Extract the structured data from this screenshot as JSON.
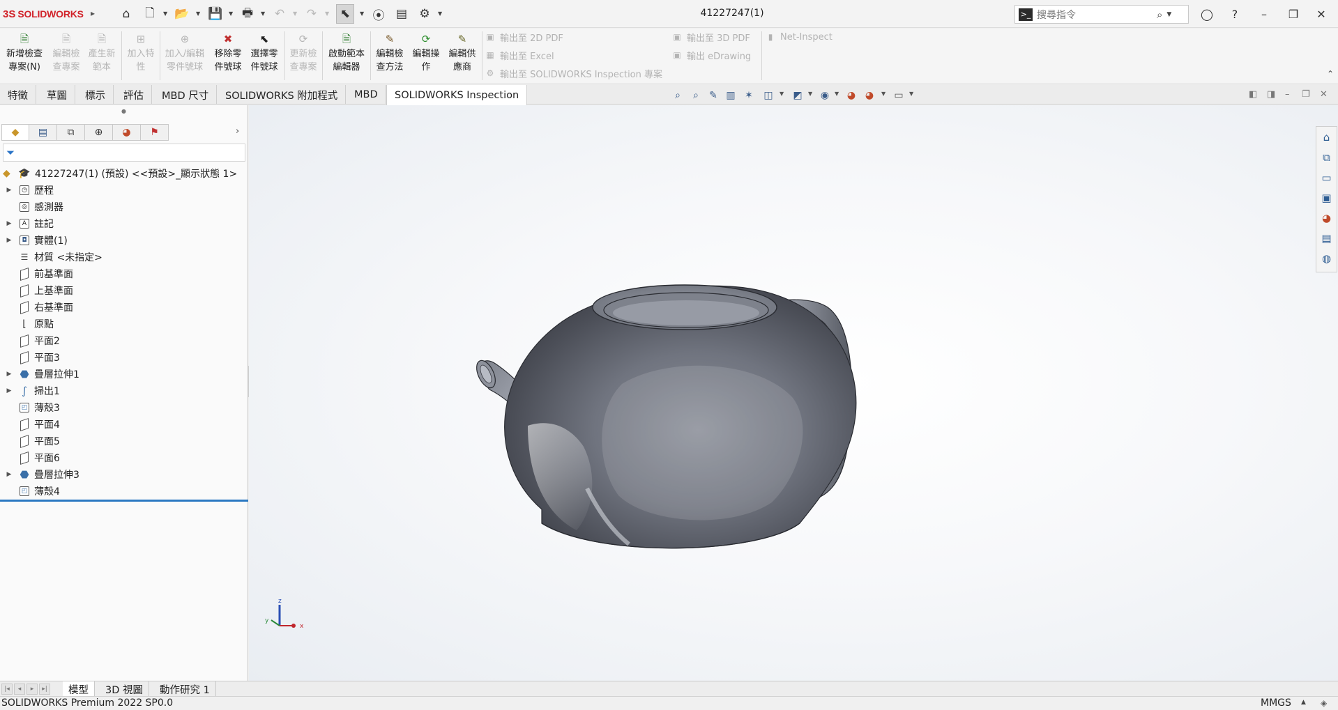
{
  "app": {
    "brand_ds": "3S",
    "brand_name": "SOLIDWORKS",
    "document_title": "41227247(1)"
  },
  "search": {
    "placeholder": "搜尋指令"
  },
  "ribbon": {
    "buttons": [
      {
        "line1": "新增檢查",
        "line2": "專案(N)",
        "enabled": true,
        "icon": "new-inspection-icon"
      },
      {
        "line1": "編輯檢",
        "line2": "查專案",
        "enabled": false,
        "icon": "edit-inspection-icon"
      },
      {
        "line1": "產生新",
        "line2": "範本",
        "enabled": false,
        "icon": "new-template-icon"
      },
      {
        "line1": "加入特",
        "line2": "性",
        "enabled": false,
        "icon": "add-characteristic-icon"
      },
      {
        "line1": "加入/編輯",
        "line2": "零件號球",
        "enabled": false,
        "icon": "add-balloon-icon"
      },
      {
        "line1": "移除零",
        "line2": "件號球",
        "enabled": true,
        "icon": "remove-balloon-icon"
      },
      {
        "line1": "選擇零",
        "line2": "件號球",
        "enabled": true,
        "icon": "select-balloon-icon"
      },
      {
        "line1": "更新檢",
        "line2": "查專案",
        "enabled": false,
        "icon": "update-project-icon"
      },
      {
        "line1": "啟動範本",
        "line2": "編輯器",
        "enabled": true,
        "icon": "template-editor-icon"
      },
      {
        "line1": "編輯檢",
        "line2": "查方法",
        "enabled": true,
        "icon": "edit-method-icon"
      },
      {
        "line1": "編輯操",
        "line2": "作",
        "enabled": true,
        "icon": "edit-operation-icon"
      },
      {
        "line1": "編輯供",
        "line2": "應商",
        "enabled": true,
        "icon": "edit-vendor-icon"
      }
    ],
    "export_2d_pdf": "輸出至 2D PDF",
    "export_excel": "輸出至 Excel",
    "export_inspection": "輸出至 SOLIDWORKS Inspection 專案",
    "export_3d_pdf": "輸出至 3D PDF",
    "export_edrawing": "輸出 eDrawing",
    "net_inspect": "Net-Inspect"
  },
  "tabs": [
    "特徵",
    "草圖",
    "標示",
    "評估",
    "MBD 尺寸",
    "SOLIDWORKS 附加程式",
    "MBD",
    "SOLIDWORKS Inspection"
  ],
  "active_tab": "SOLIDWORKS Inspection",
  "tree": {
    "root": "41227247(1) (預設) <<預設>_顯示狀態 1>",
    "items": [
      {
        "label": "歷程",
        "expandable": true,
        "icon": "history-icon"
      },
      {
        "label": "感測器",
        "expandable": false,
        "icon": "sensor-icon"
      },
      {
        "label": "註記",
        "expandable": true,
        "icon": "annotation-icon"
      },
      {
        "label": "實體(1)",
        "expandable": true,
        "icon": "solid-body-icon"
      },
      {
        "label": "材質 <未指定>",
        "expandable": false,
        "icon": "material-icon"
      },
      {
        "label": "前基準面",
        "expandable": false,
        "icon": "plane-icon"
      },
      {
        "label": "上基準面",
        "expandable": false,
        "icon": "plane-icon"
      },
      {
        "label": "右基準面",
        "expandable": false,
        "icon": "plane-icon"
      },
      {
        "label": "原點",
        "expandable": false,
        "icon": "origin-icon"
      },
      {
        "label": "平面2",
        "expandable": false,
        "icon": "plane-icon"
      },
      {
        "label": "平面3",
        "expandable": false,
        "icon": "plane-icon"
      },
      {
        "label": "疊層拉伸1",
        "expandable": true,
        "icon": "loft-icon"
      },
      {
        "label": "掃出1",
        "expandable": true,
        "icon": "sweep-icon"
      },
      {
        "label": "薄殼3",
        "expandable": false,
        "icon": "shell-icon"
      },
      {
        "label": "平面4",
        "expandable": false,
        "icon": "plane-icon"
      },
      {
        "label": "平面5",
        "expandable": false,
        "icon": "plane-icon"
      },
      {
        "label": "平面6",
        "expandable": false,
        "icon": "plane-icon"
      },
      {
        "label": "疊層拉伸3",
        "expandable": true,
        "icon": "loft-icon"
      },
      {
        "label": "薄殼4",
        "expandable": false,
        "icon": "shell-icon"
      }
    ]
  },
  "triad": {
    "x": "x",
    "y": "y",
    "z": "z"
  },
  "bottom_tabs": [
    "模型",
    "3D 視圖",
    "動作研究 1"
  ],
  "active_bottom_tab": "模型",
  "status": {
    "text": "SOLIDWORKS Premium 2022 SP0.0",
    "units": "MMGS"
  },
  "colors": {
    "brand_red": "#d1232a",
    "rollback_bar": "#2b79c2",
    "model_gray": "#6b6f7a"
  }
}
